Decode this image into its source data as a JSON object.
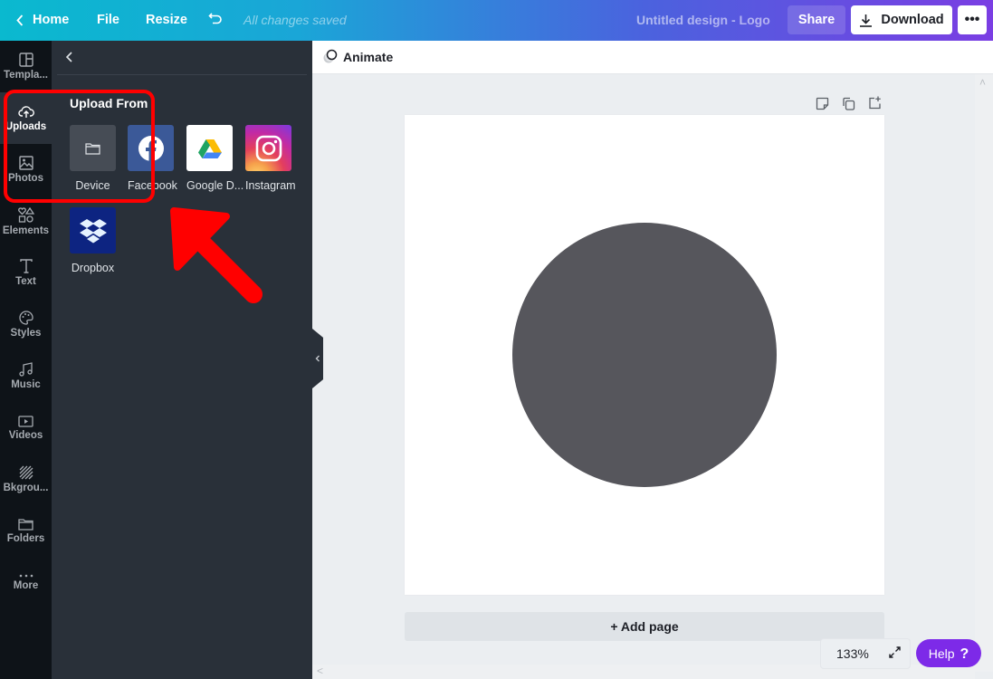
{
  "topbar": {
    "home_label": "Home",
    "file_label": "File",
    "resize_label": "Resize",
    "save_status": "All changes saved",
    "design_title": "Untitled design - Logo",
    "share_label": "Share",
    "download_label": "Download",
    "more_label": "•••"
  },
  "rail": {
    "items": [
      {
        "label": "Templa...",
        "icon": "template-icon"
      },
      {
        "label": "Uploads",
        "icon": "cloud-upload-icon",
        "active": true
      },
      {
        "label": "Photos",
        "icon": "image-icon"
      },
      {
        "label": "Elements",
        "icon": "shapes-icon"
      },
      {
        "label": "Text",
        "icon": "text-icon"
      },
      {
        "label": "Styles",
        "icon": "palette-icon"
      },
      {
        "label": "Music",
        "icon": "music-note-icon"
      },
      {
        "label": "Videos",
        "icon": "video-icon"
      },
      {
        "label": "Bkgrou...",
        "icon": "background-icon"
      },
      {
        "label": "Folders",
        "icon": "folder-icon"
      },
      {
        "label": "More",
        "icon": "more-dots-icon"
      }
    ]
  },
  "panel": {
    "heading": "Upload From",
    "sources": [
      {
        "label": "Device",
        "icon": "folder-icon"
      },
      {
        "label": "Facebook",
        "icon": "facebook-icon"
      },
      {
        "label": "Google D...",
        "icon": "google-drive-icon"
      },
      {
        "label": "Instagram",
        "icon": "instagram-icon"
      },
      {
        "label": "Dropbox",
        "icon": "dropbox-icon"
      }
    ]
  },
  "canvas": {
    "animate_label": "Animate",
    "add_page_label": "+ Add page",
    "zoom_level": "133%",
    "help_label": "Help",
    "help_glyph": "?",
    "shape_color": "#56565c"
  },
  "colors": {
    "accent_purple": "#7d2ae8",
    "annotation_red": "#ff0000"
  }
}
